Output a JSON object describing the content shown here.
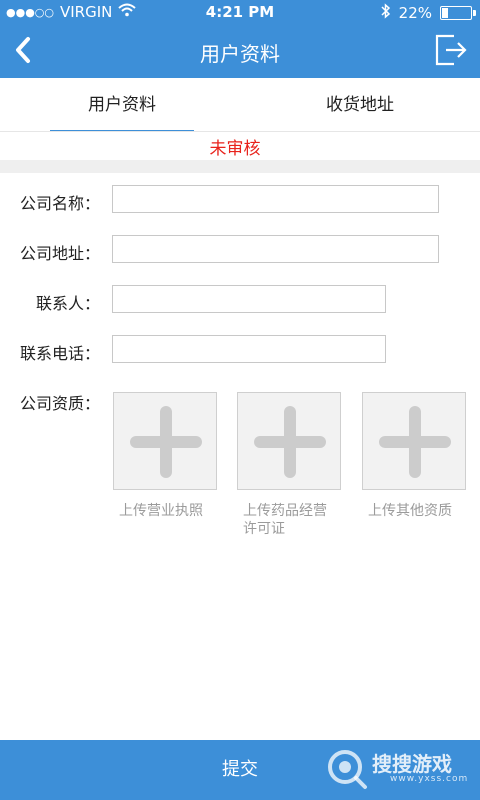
{
  "status_bar": {
    "signal": "●●●○○",
    "carrier": "VIRGIN",
    "time": "4:21 PM",
    "battery_text": "22%",
    "battery_level": 0.22,
    "icons": [
      "wifi-icon",
      "bluetooth-icon",
      "battery-icon"
    ]
  },
  "nav": {
    "title": "用户资料",
    "back_icon": "chevron-left-icon",
    "exit_icon": "logout-icon"
  },
  "tabs": [
    {
      "label": "用户资料",
      "active": true
    },
    {
      "label": "收货地址",
      "active": false
    }
  ],
  "audit_status": "未审核",
  "form": {
    "company_name": {
      "label": "公司名称：",
      "value": ""
    },
    "company_address": {
      "label": "公司地址：",
      "value": ""
    },
    "contact_person": {
      "label": "联系人：",
      "value": ""
    },
    "contact_phone": {
      "label": "联系电话：",
      "value": ""
    },
    "qualification": {
      "label": "公司资质："
    }
  },
  "uploads": [
    {
      "caption": "上传营业执照"
    },
    {
      "caption_line1": "上传药品经营",
      "caption_line2": "许可证"
    },
    {
      "caption": "上传其他资质"
    }
  ],
  "submit_label": "提交",
  "watermark": {
    "text": "搜搜游戏",
    "url": "www.yxss.com"
  },
  "colors": {
    "primary": "#3d8fd8",
    "audit_red": "#e8231c",
    "placeholder_gray": "#cfcfcf"
  }
}
